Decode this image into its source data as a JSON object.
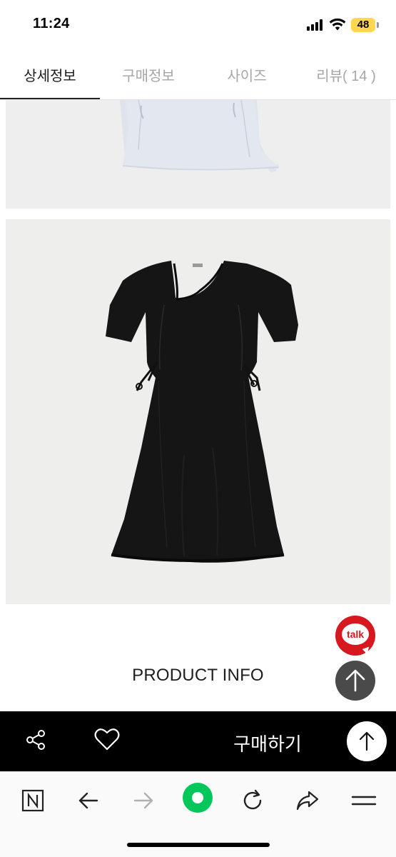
{
  "status_bar": {
    "time": "11:24",
    "battery": "48",
    "icons": [
      "cellular-signal-icon",
      "wifi-icon",
      "battery-icon"
    ]
  },
  "tabs": [
    {
      "label": "상세정보",
      "active": true
    },
    {
      "label": "구매정보",
      "active": false
    },
    {
      "label": "사이즈",
      "active": false
    },
    {
      "label": "리뷰( 14 )",
      "active": false
    }
  ],
  "content": {
    "product_info_heading": "PRODUCT INFO",
    "photos": [
      "light-blue-garment-photo",
      "black-dress-photo"
    ]
  },
  "floating": {
    "talk_label": "talk",
    "talk_color": "#d8181f",
    "scroll_up_icon": "arrow-up-icon"
  },
  "buy_bar": {
    "buy_label": "구매하기",
    "share_icon": "share-icon",
    "like_icon": "heart-icon",
    "top_icon": "arrow-up-icon"
  },
  "browser_bar": {
    "icons": [
      "naver-n-icon",
      "back-arrow-icon",
      "forward-arrow-icon",
      "green-home-icon",
      "reload-icon",
      "share-arrow-icon",
      "menu-icon"
    ],
    "accent": "#03c75a"
  }
}
